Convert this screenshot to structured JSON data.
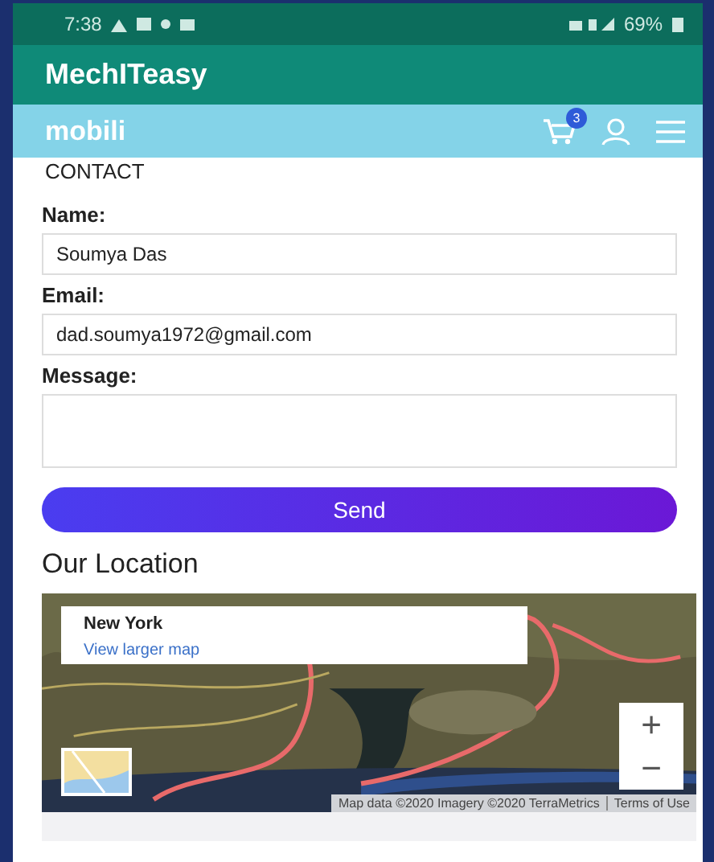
{
  "status_bar": {
    "time": "7:38",
    "battery": "69%"
  },
  "app_bar": {
    "title": "MechITeasy"
  },
  "nav": {
    "brand": "mobili",
    "cart_count": "3"
  },
  "section_heading": "CONTACT",
  "form": {
    "fields": [
      {
        "kind": "input",
        "label": "Name:",
        "value": "Soumya Das"
      },
      {
        "kind": "input",
        "label": "Email:",
        "value": "dad.soumya1972@gmail.com"
      },
      {
        "kind": "textarea",
        "label": "Message:"
      }
    ],
    "submit": "Send"
  },
  "location": {
    "heading": "Our Location",
    "map": {
      "kind": "picture",
      "place": "New York",
      "link": "View larger map",
      "zoom_in": "+",
      "zoom_out": "−",
      "attribution": "Map data ©2020 Imagery ©2020 TerraMetrics",
      "terms": "Terms of Use"
    }
  }
}
